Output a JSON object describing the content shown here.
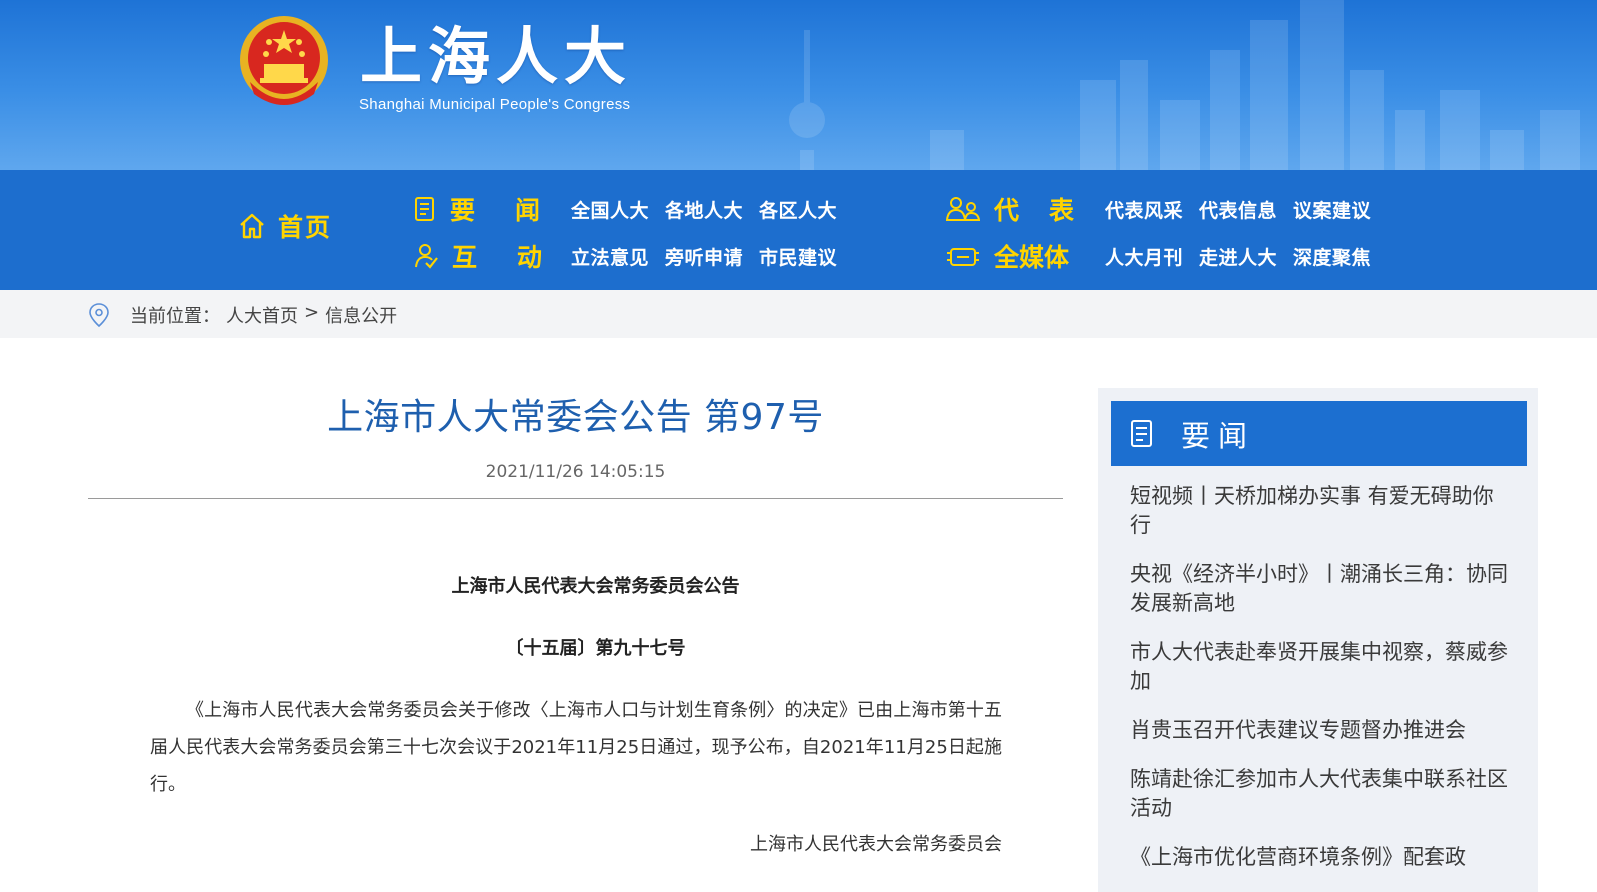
{
  "header": {
    "title": "上海人大",
    "subtitle": "Shanghai Municipal People's Congress"
  },
  "nav": {
    "home": "首页",
    "groups": [
      {
        "label": [
          "要",
          "闻"
        ],
        "icon": "document-icon",
        "links": [
          "全国人大",
          "各地人大",
          "各区人大"
        ]
      },
      {
        "label": [
          "互",
          "动"
        ],
        "icon": "person-check-icon",
        "links": [
          "立法意见",
          "旁听申请",
          "市民建议"
        ]
      },
      {
        "label": [
          "代",
          "表"
        ],
        "icon": "people-icon",
        "links": [
          "代表风采",
          "代表信息",
          "议案建议"
        ]
      },
      {
        "label": [
          "全媒体"
        ],
        "icon": "media-icon",
        "links": [
          "人大月刊",
          "走进人大",
          "深度聚焦"
        ]
      }
    ]
  },
  "breadcrumb": {
    "prefix": "当前位置：",
    "home": "人大首页",
    "separator": ">",
    "current": "信息公开"
  },
  "article": {
    "title": "上海市人大常委会公告 第97号",
    "date": "2021/11/26 14:05:15",
    "heading": "上海市人民代表大会常务委员会公告",
    "number": "〔十五届〕第九十七号",
    "body": "《上海市人民代表大会常务委员会关于修改〈上海市人口与计划生育条例〉的决定》已由上海市第十五届人民代表大会常务委员会第三十七次会议于2021年11月25日通过，现予公布，自2021年11月25日起施行。",
    "signature": "上海市人民代表大会常务委员会"
  },
  "sidebar": {
    "title": "要闻",
    "items": [
      "短视频丨天桥加梯办实事 有爱无碍助你行",
      "央视《经济半小时》丨潮涌长三角：协同发展新高地",
      "市人大代表赴奉贤开展集中视察，蔡威参加",
      "肖贵玉召开代表建议专题督办推进会",
      "陈靖赴徐汇参加市人大代表集中联系社区活动",
      "《上海市优化营商环境条例》配套政"
    ]
  },
  "colors": {
    "header_blue": "#1e73d6",
    "nav_yellow": "#ffd400",
    "title_blue": "#1e5fae",
    "sidebar_header": "#1c6fd0"
  }
}
